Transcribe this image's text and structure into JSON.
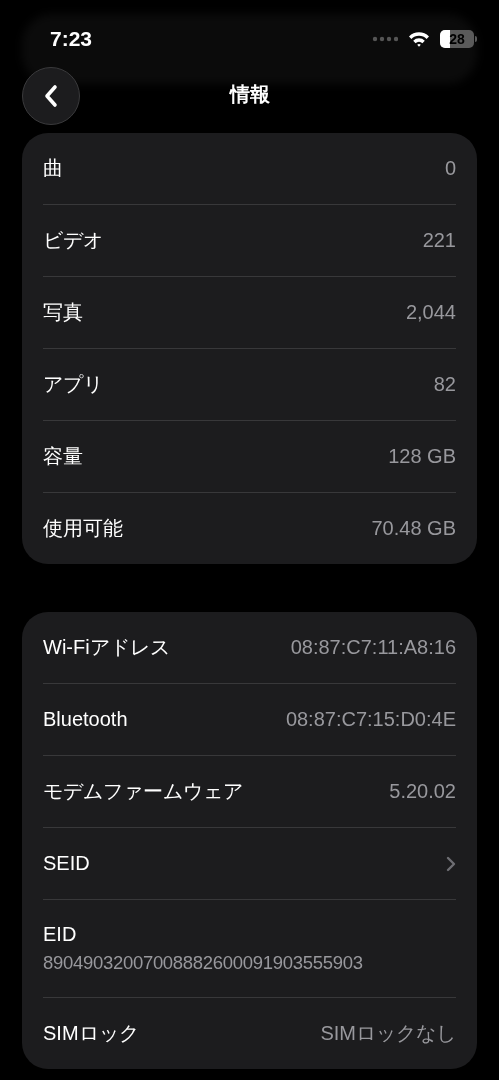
{
  "status_bar": {
    "time": "7:23",
    "battery": "28"
  },
  "nav": {
    "title": "情報"
  },
  "sections": [
    {
      "rows": [
        {
          "kind": "value",
          "label": "曲",
          "value": "0"
        },
        {
          "kind": "value",
          "label": "ビデオ",
          "value": "221"
        },
        {
          "kind": "value",
          "label": "写真",
          "value": "2,044"
        },
        {
          "kind": "value",
          "label": "アプリ",
          "value": "82"
        },
        {
          "kind": "value",
          "label": "容量",
          "value": "128 GB"
        },
        {
          "kind": "value",
          "label": "使用可能",
          "value": "70.48 GB"
        }
      ]
    },
    {
      "rows": [
        {
          "kind": "value",
          "label": "Wi-Fiアドレス",
          "value": "08:87:C7:11:A8:16"
        },
        {
          "kind": "value",
          "label": "Bluetooth",
          "value": "08:87:C7:15:D0:4E"
        },
        {
          "kind": "value",
          "label": "モデムファームウェア",
          "value": "5.20.02"
        },
        {
          "kind": "chevron",
          "label": "SEID"
        },
        {
          "kind": "stacked",
          "label": "EID",
          "value": "89049032007008882600091903555903"
        },
        {
          "kind": "value",
          "label": "SIMロック",
          "value": "SIMロックなし"
        }
      ]
    }
  ]
}
